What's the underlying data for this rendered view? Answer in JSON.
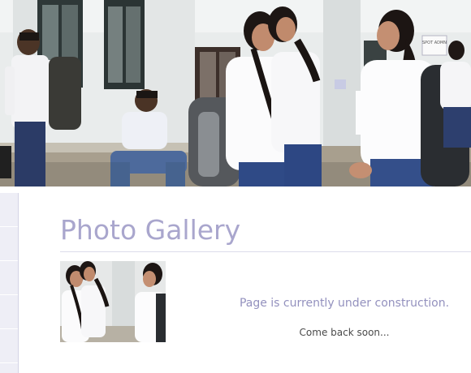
{
  "banner": {
    "poster_text": "SPOT ADMN"
  },
  "sidebar": {
    "items": [
      "",
      "",
      "",
      "",
      ""
    ]
  },
  "main": {
    "title": "Photo Gallery",
    "notice": "Page is currently under construction.",
    "subnotice": "Come back soon..."
  },
  "colors": {
    "title": "#a9a6cd",
    "notice": "#9391be",
    "subnotice": "#4a4a4a",
    "sidebar_bg": "#eeeef6",
    "rule": "#dcdcea"
  }
}
